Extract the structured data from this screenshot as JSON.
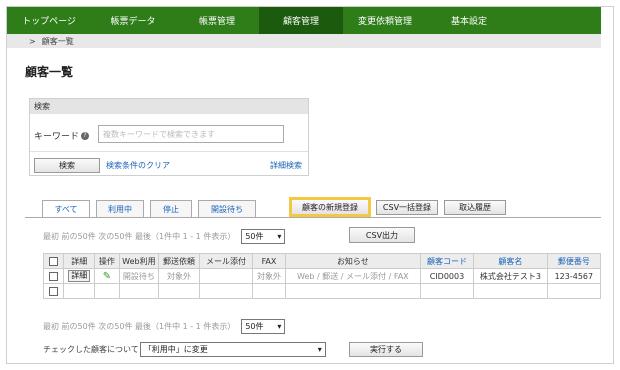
{
  "nav": {
    "items": [
      "トップページ",
      "帳票データ",
      "帳票管理",
      "顧客管理",
      "変更依頼管理",
      "基本設定"
    ]
  },
  "breadcrumb": {
    "sep": ">",
    "text": "顧客一覧"
  },
  "page_title": "顧客一覧",
  "search": {
    "header": "検索",
    "keyword_label": "キーワード",
    "help": "?",
    "placeholder": "複数キーワードで検索できます",
    "search_button": "検索",
    "clear_link": "検索条件のクリア",
    "advanced_link": "詳細検索"
  },
  "tabs": [
    "すべて",
    "利用中",
    "停止",
    "開設待ち"
  ],
  "toolbar": {
    "new_customer": "顧客の新規登録",
    "csv_bulk": "CSV一括登録",
    "import_history": "取込履歴",
    "csv_export": "CSV出力"
  },
  "pager": {
    "text": "最初 前の50件 次の50件 最後（1件中 1 - 1 件表示）",
    "per_page": "50件"
  },
  "table": {
    "headers": [
      "詳細",
      "操作",
      "Web利用",
      "郵送依頼",
      "メール添付",
      "FAX",
      "お知らせ",
      "顧客コード",
      "顧客名",
      "郵便番号"
    ],
    "rows": [
      {
        "detail": "詳細",
        "web": "開設待ち",
        "mail_request": "対象外",
        "email": "",
        "fax": "対象外",
        "notice": "Web / 郵送 / メール添付 / FAX",
        "code": "CID0003",
        "name": "株式会社テスト3",
        "zip": "123-4567"
      }
    ]
  },
  "bottom": {
    "label": "チェックした顧客について",
    "action": "「利用中」に変更",
    "execute": "実行する"
  },
  "colors": {
    "nav_bg": "#2e7d19",
    "nav_active": "#1c5a0d",
    "link": "#1a62b8",
    "highlight": "#f4c842"
  }
}
